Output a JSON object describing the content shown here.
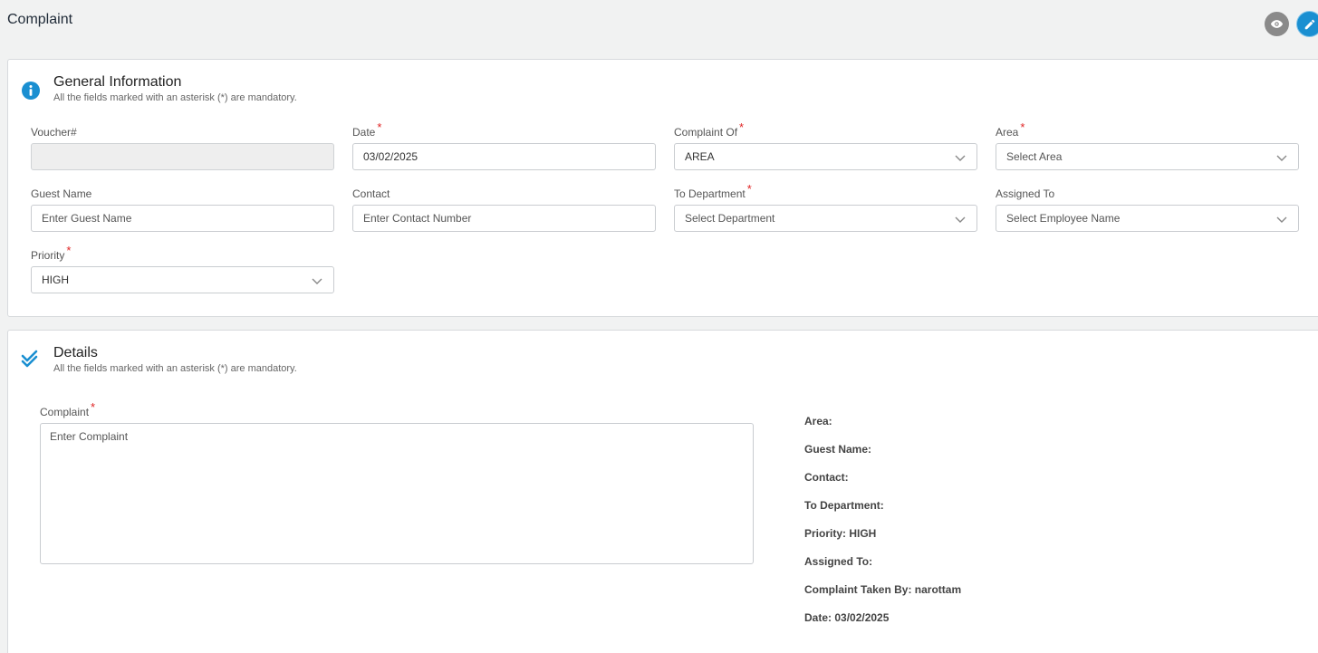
{
  "page": {
    "title": "Complaint"
  },
  "toolbar": {
    "view_icon": "eye-icon",
    "edit_icon": "pencil-icon"
  },
  "general": {
    "title": "General Information",
    "subtitle": "All the fields marked with an asterisk (*) are mandatory.",
    "icon": "info-icon",
    "fields": {
      "voucher": {
        "label": "Voucher#",
        "value": ""
      },
      "date": {
        "label": "Date",
        "value": "03/02/2025"
      },
      "complaint_of": {
        "label": "Complaint Of",
        "value": "AREA"
      },
      "area": {
        "label": "Area",
        "placeholder": "Select Area"
      },
      "guest_name": {
        "label": "Guest Name",
        "placeholder": "Enter Guest Name"
      },
      "contact": {
        "label": "Contact",
        "placeholder": "Enter Contact Number"
      },
      "to_department": {
        "label": "To Department",
        "placeholder": "Select Department"
      },
      "assigned_to": {
        "label": "Assigned To",
        "placeholder": "Select Employee Name"
      },
      "priority": {
        "label": "Priority",
        "value": "HIGH"
      }
    },
    "required_marker": "*"
  },
  "details": {
    "title": "Details",
    "subtitle": "All the fields marked with an asterisk (*) are mandatory.",
    "icon": "double-check-icon",
    "complaint": {
      "label": "Complaint",
      "placeholder": "Enter Complaint"
    },
    "summary": [
      "Area:",
      "Guest Name:",
      "Contact:",
      "To Department:",
      "Priority: HIGH",
      "Assigned To:",
      "Complaint Taken By: narottam",
      "Date: 03/02/2025"
    ]
  },
  "colors": {
    "accent": "#1a8fd1",
    "required": "#e02424",
    "background": "#f1f2f2"
  }
}
